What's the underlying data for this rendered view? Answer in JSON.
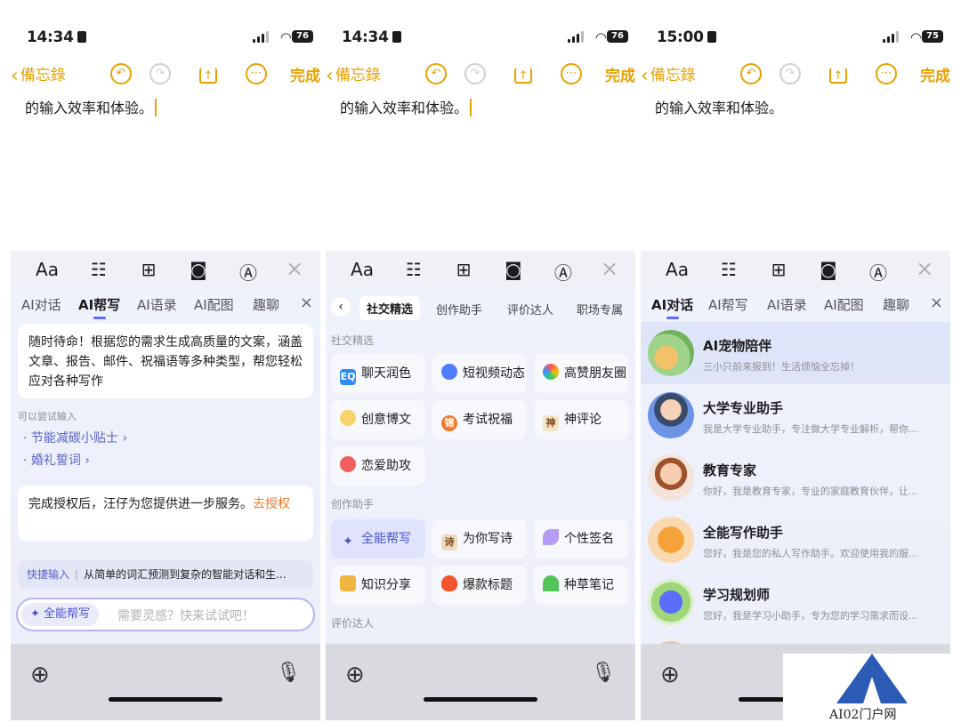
{
  "panels": [
    {
      "status": {
        "time": "14:34",
        "battery": "76"
      },
      "nav": {
        "back": "備忘錄",
        "done": "完成"
      },
      "doc_text": "的输入效率和体验。",
      "kb_tabs": [
        "AI对话",
        "AI帮写",
        "AI语录",
        "AI配图",
        "趣聊"
      ],
      "intro": "随时待命！根据您的需求生成高质量的文案，涵盖文章、报告、邮件、祝福语等多种类型，帮您轻松应对各种写作",
      "try_hint": "可以尝试输入",
      "suggestions": [
        "· 节能减碳小贴士 ›",
        "· 婚礼誓词 ›"
      ],
      "auth_text": "完成授权后，汪仔为您提供进一步服务。",
      "auth_link": "去授权",
      "quick_label": "快捷输入",
      "quick_text": "从简单的词汇预测到复杂的智能对话和生...",
      "chip": "✦ 全能帮写",
      "placeholder": "需要灵感？快来试试吧！"
    },
    {
      "status": {
        "time": "14:34",
        "battery": "76"
      },
      "nav": {
        "back": "備忘錄",
        "done": "完成"
      },
      "doc_text": "的输入效率和体验。",
      "subtabs": [
        "社交精选",
        "创作助手",
        "评价达人",
        "职场专属"
      ],
      "section1": "社交精选",
      "pills1": [
        "聊天润色",
        "短视频动态",
        "高赞朋友圈",
        "创意博文",
        "考试祝福",
        "神评论",
        "恋爱助攻"
      ],
      "section2": "创作助手",
      "pills2": [
        "全能帮写",
        "为你写诗",
        "个性签名",
        "知识分享",
        "爆款标题",
        "种草笔记"
      ],
      "section3": "评价达人",
      "icon_labels": {
        "eq": "EQ",
        "jin": "锦",
        "shen": "神",
        "shi": "诗"
      }
    },
    {
      "status": {
        "time": "15:00",
        "battery": "75"
      },
      "nav": {
        "back": "備忘錄",
        "done": "完成"
      },
      "doc_text": "的输入效率和体验。",
      "kb_tabs": [
        "AI对话",
        "AI帮写",
        "AI语录",
        "AI配图",
        "趣聊"
      ],
      "assistants": [
        {
          "name": "AI宠物陪伴",
          "desc": "三小只前来报到！生活烦恼全忘掉！"
        },
        {
          "name": "大学专业助手",
          "desc": "我是大学专业助手，专注做大学专业解析，帮你..."
        },
        {
          "name": "教育专家",
          "desc": "你好，我是教育专家，专业的家庭教育伙伴，让..."
        },
        {
          "name": "全能写作助手",
          "desc": "您好，我是您的私人写作助手。欢迎使用我的服..."
        },
        {
          "name": "学习规划师",
          "desc": "您好，我是学习小助手，专为您的学习需求而设..."
        }
      ]
    }
  ],
  "watermark": "AI02门户网",
  "colors": {
    "accent": "#e8a200",
    "ai_blue": "#5b6cff",
    "link_orange": "#f07a2c"
  },
  "icons": [
    "chevron-left-icon",
    "undo-icon",
    "redo-icon",
    "share-icon",
    "more-icon",
    "font-icon",
    "checklist-icon",
    "table-icon",
    "camera-icon",
    "pen-icon",
    "close-icon",
    "globe-icon",
    "mic-icon",
    "sparkle-icon"
  ]
}
